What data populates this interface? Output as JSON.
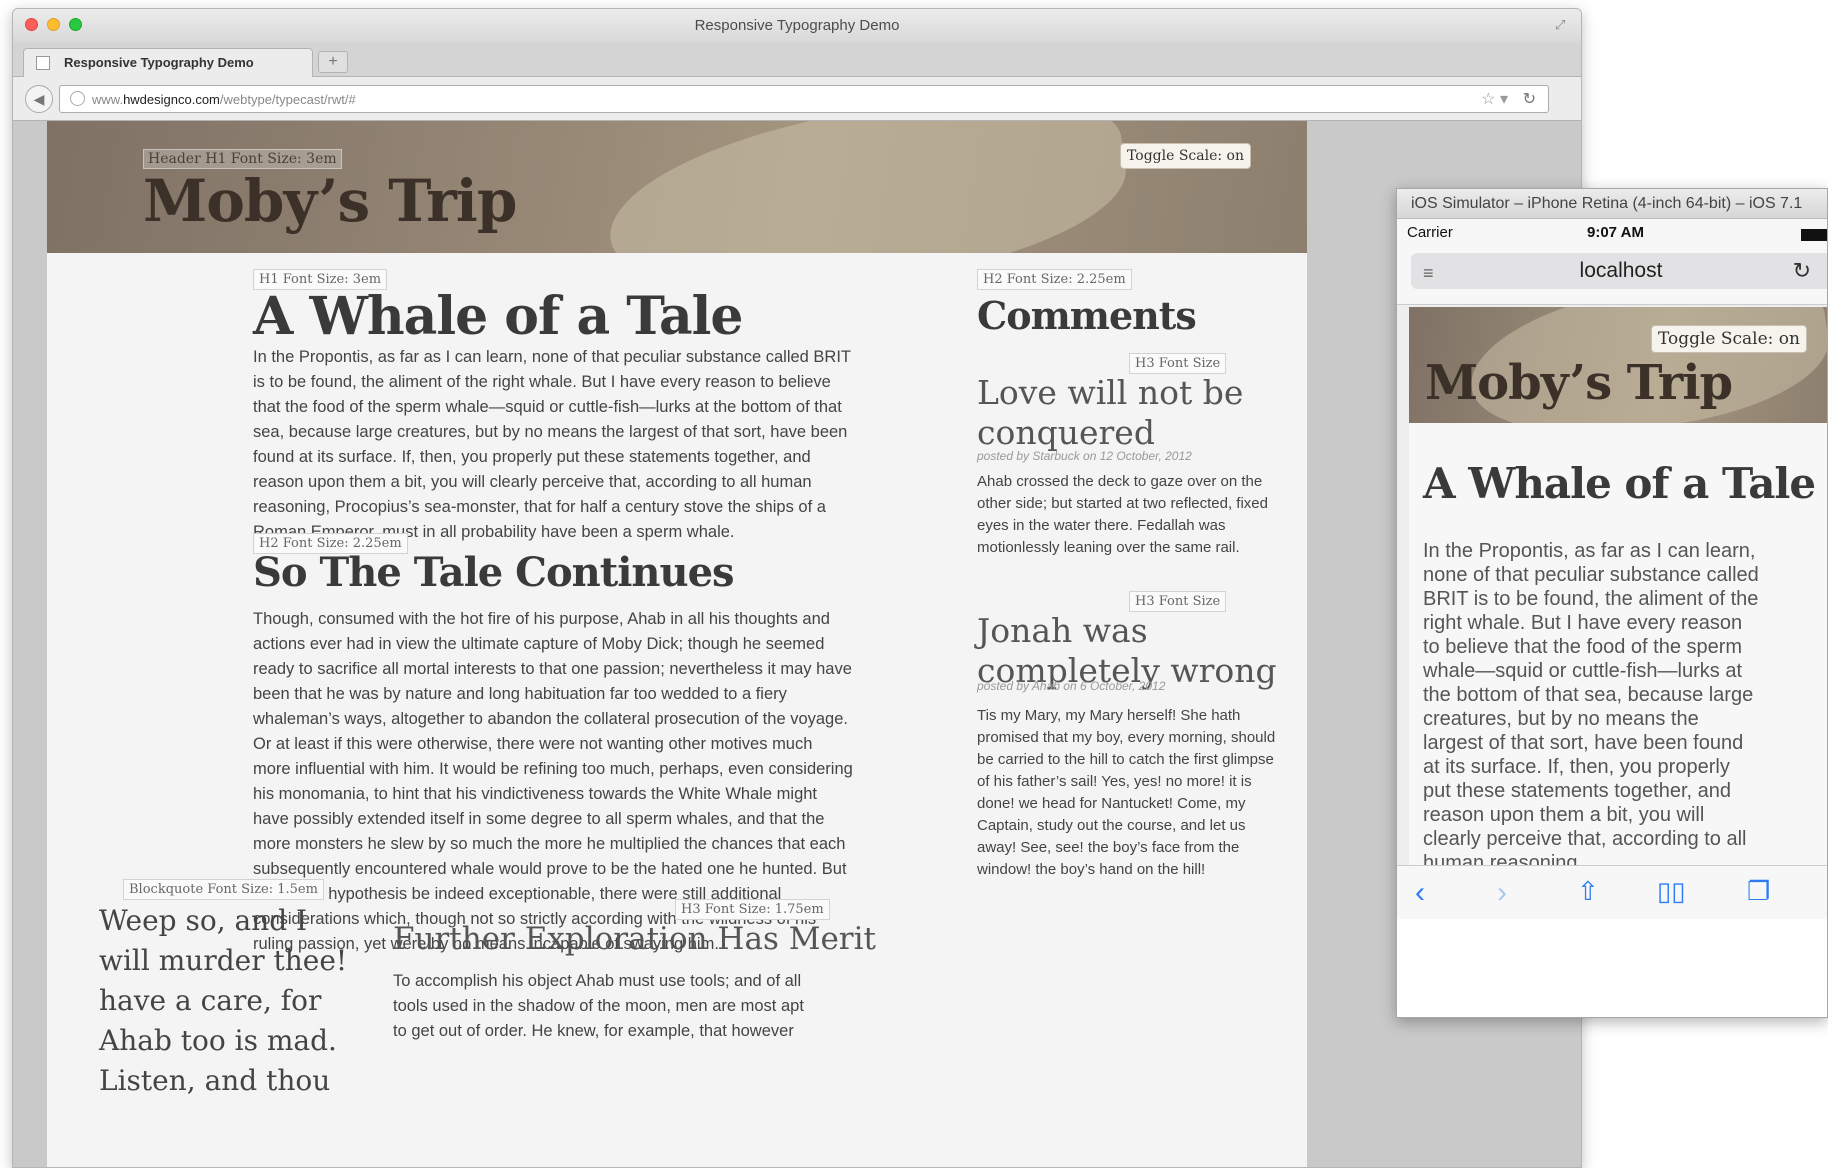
{
  "window": {
    "title": "Responsive Typography Demo"
  },
  "tab": {
    "label": "Responsive Typography Demo",
    "new_tab": "+"
  },
  "address": {
    "prefix": "www.",
    "domain": "hwdesignco.com",
    "path": "/webtype/typecast/rwt/#"
  },
  "hero": {
    "label": "Header H1 Font Size: 3em",
    "title": "Moby’s Trip",
    "toggle": "Toggle Scale: on"
  },
  "main": {
    "h1_label": "H1 Font Size: 3em",
    "h1": "A Whale of a Tale",
    "p1": "In the Propontis, as far as I can learn, none of that peculiar substance called BRIT is to be found, the aliment of the right whale. But I have every reason to believe that the food of the sperm whale—squid or cuttle-fish—lurks at the bottom of that sea, because large creatures, but by no means the largest of that sort, have been found at its surface. If, then, you properly put these statements together, and reason upon them a bit, you will clearly perceive that, according to all human reasoning, Procopius’s sea-monster, that for half a century stove the ships of a Roman Emperor, must in all probability have been a sperm whale.",
    "h2_label": "H2 Font Size: 2.25em",
    "h2": "So The Tale Continues",
    "p2": "Though, consumed with the hot fire of his purpose, Ahab in all his thoughts and actions ever had in view the ultimate capture of Moby Dick; though he seemed ready to sacrifice all mortal interests to that one passion; nevertheless it may have been that he was by nature and long habituation far too wedded to a fiery whaleman’s ways, altogether to abandon the collateral prosecution of the voyage. Or at least if this were otherwise, there were not wanting other motives much more influential with him. It would be refining too much, perhaps, even considering his monomania, to hint that his vindictiveness towards the White Whale might have possibly extended itself in some degree to all sperm whales, and that the more monsters he slew by so much the more he multiplied the chances that each subsequently encountered whale would prove to be the hated one he hunted. But if such an hypothesis be indeed exceptionable, there were still additional considerations which, though not so strictly according with the wildness of his ruling passion, yet were by no means incapable of swaying him.",
    "bq_label": "Blockquote Font Size: 1.5em",
    "bq": "Weep so, and I will murder thee! have a care, for Ahab too is mad. Listen, and thou",
    "h3_label": "H3 Font Size: 1.75em",
    "h3": "Further Exploration Has Merit",
    "p3": "To accomplish his object Ahab must use tools; and of all tools used in the shadow of the moon, men are most apt to get out of order. He knew, for example, that however"
  },
  "comments": {
    "label": "H2 Font Size: 2.25em",
    "title": "Comments",
    "items": [
      {
        "label": "H3 Font Size",
        "title": "Love will not be conquered",
        "byline": "posted by Starbuck on 12 October, 2012",
        "text": "Ahab crossed the deck to gaze over on the other side; but started at two reflected, fixed eyes in the water there. Fedallah was motionlessly leaning over the same rail."
      },
      {
        "label": "H3 Font Size",
        "title": "Jonah was completely wrong",
        "byline": "posted by Ahab on 6 October, 2012",
        "text": "Tis my Mary, my Mary herself! She hath promised that my boy, every morning, should be carried to the hill to catch the first glimpse of his father’s sail! Yes, yes! no more! it is done! we head for Nantucket! Come, my Captain, study out the course, and let us away! See, see! the boy’s face from the window! the boy’s hand on the hill!"
      }
    ]
  },
  "simulator": {
    "title": "iOS Simulator – iPhone Retina (4-inch 64-bit) – iOS 7.1",
    "carrier": "Carrier",
    "time": "9:07 AM",
    "url": "localhost",
    "toggle": "Toggle Scale: on",
    "hero_title": "Moby’s Trip",
    "h1": "A Whale of a Tale",
    "p": "In the Propontis, as far as I can learn, none of that peculiar substance called BRIT is to be found, the aliment of the right whale. But I have every reason to believe that the food of the sperm whale—squid or cuttle-fish—lurks at the bottom of that sea, because large creatures, but by no means the largest of that sort, have been found at its surface. If, then, you properly put these statements together, and reason upon them a bit, you will clearly perceive that, according to all human reasoning,"
  },
  "colors": {
    "accent": "#2d7cf6",
    "hero": "#8d7f6e",
    "ink": "#3a3a3a"
  }
}
